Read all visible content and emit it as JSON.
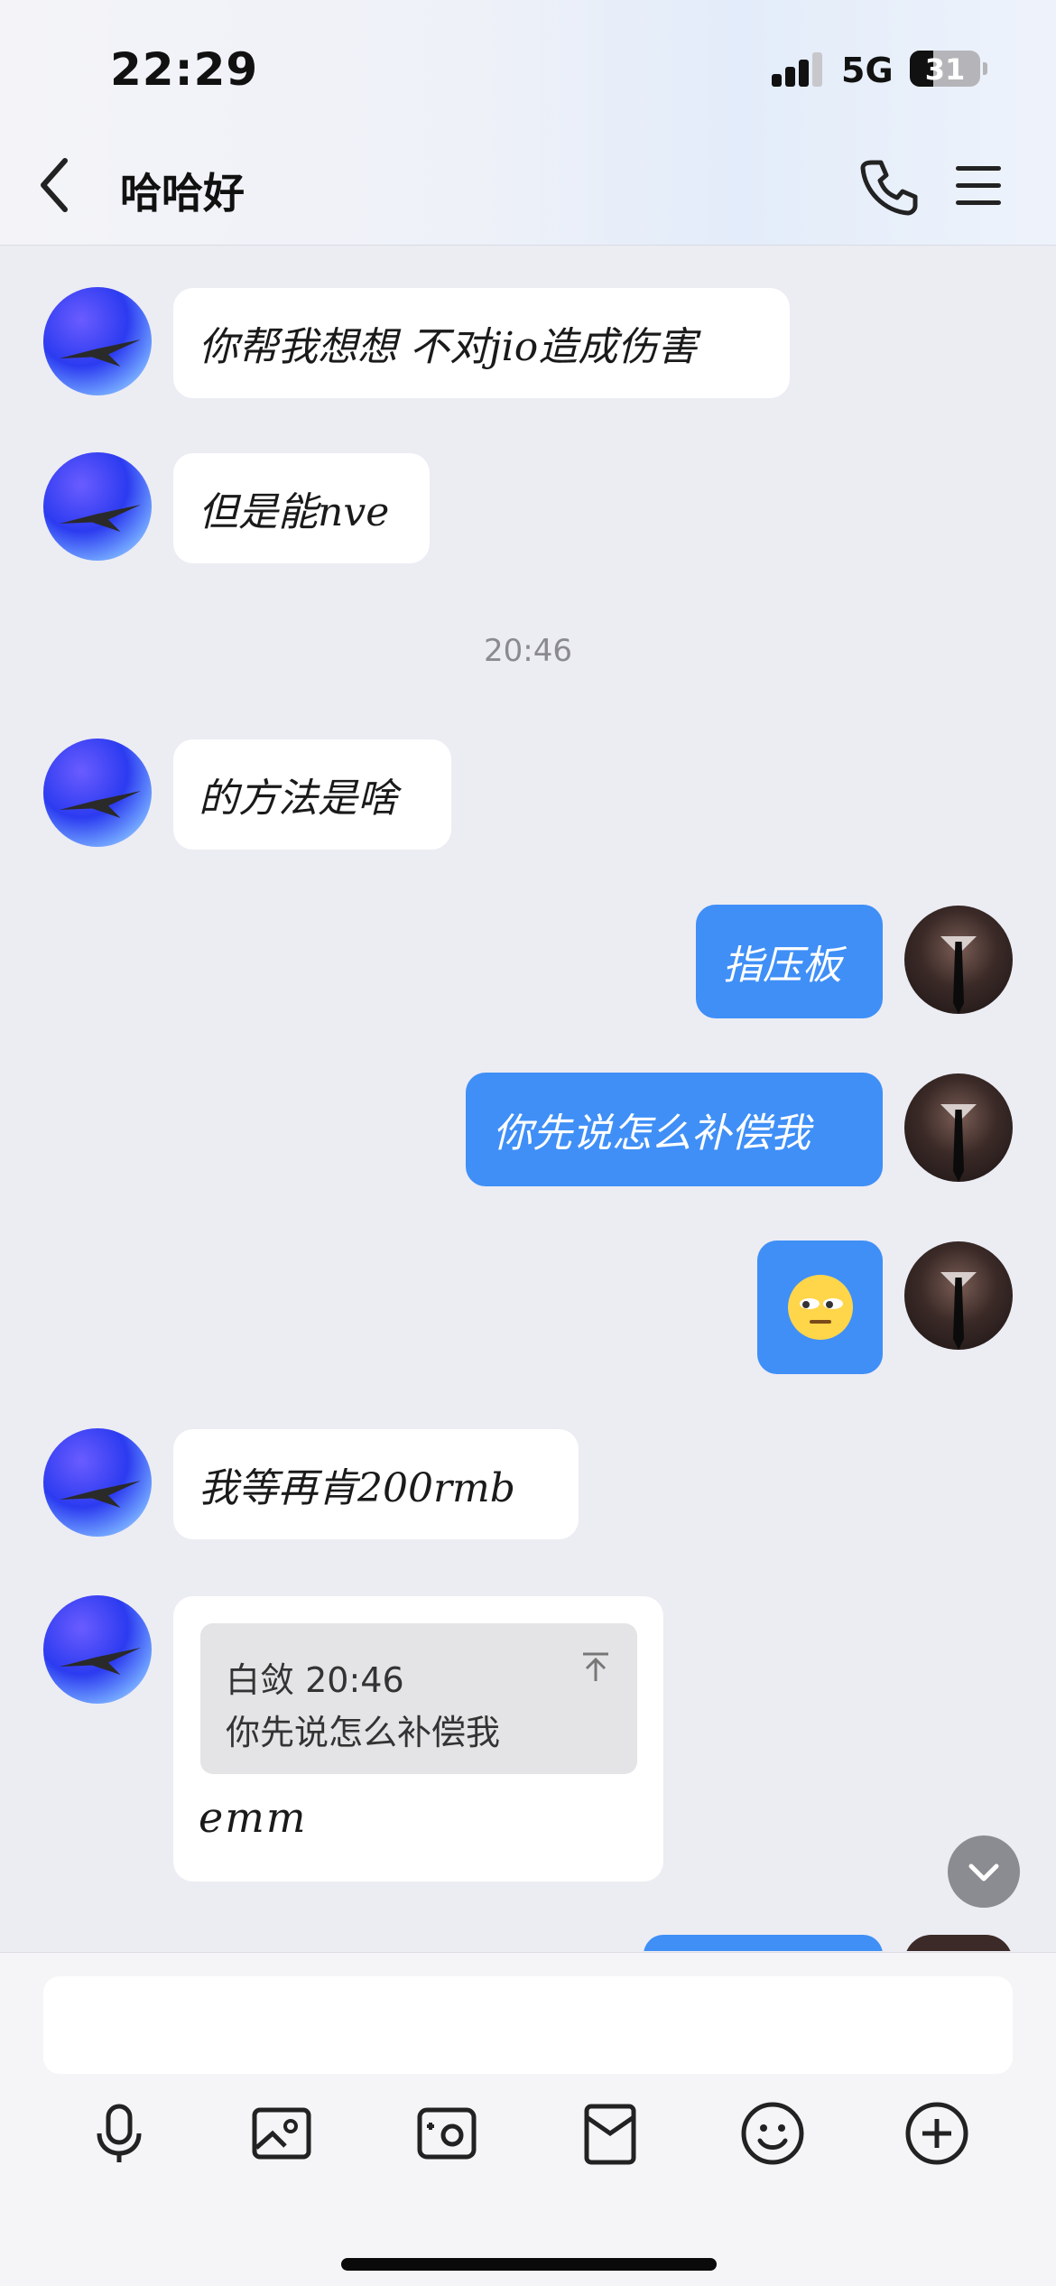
{
  "status_bar": {
    "time": "22:29",
    "network": "5G",
    "battery": "31"
  },
  "header": {
    "title": "哈哈好"
  },
  "messages": [
    {
      "side": "left",
      "text": "你帮我想想 不对jio造成伤害"
    },
    {
      "side": "left",
      "text": "但是能nve"
    },
    {
      "type": "timestamp",
      "text": "20:46"
    },
    {
      "side": "left",
      "text": "的方法是啥"
    },
    {
      "side": "right",
      "text": "指压板"
    },
    {
      "side": "right",
      "text": "你先说怎么补偿我"
    },
    {
      "side": "right",
      "emoji": "😑"
    },
    {
      "side": "left",
      "text": "我等再肯200rmb"
    },
    {
      "side": "left",
      "quote": {
        "sender": "白敛",
        "time": "20:46",
        "text": "你先说怎么补偿我"
      },
      "text": "emm"
    }
  ],
  "icons": [
    "back-arrow-icon",
    "phone-icon",
    "menu-icon",
    "microphone-icon",
    "image-icon",
    "camera-icon",
    "red-packet-icon",
    "emoji-icon",
    "plus-icon",
    "chevron-down-icon"
  ],
  "colors": {
    "accent_bubble": "#3f8ff7",
    "bubble_left": "#ffffff",
    "background": "#ececf3"
  }
}
